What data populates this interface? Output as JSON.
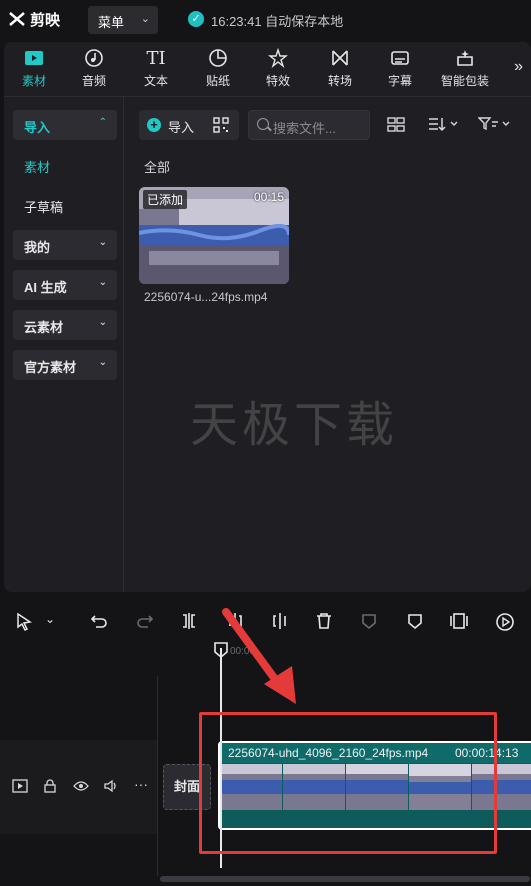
{
  "app": {
    "logo_text": "剪映",
    "menu_label": "菜单",
    "save_status": "16:23:41 自动保存本地"
  },
  "tabs": [
    {
      "label": "素材",
      "icon": "media-play-icon",
      "active": true
    },
    {
      "label": "音频",
      "icon": "audio-note-icon"
    },
    {
      "label": "文本",
      "icon": "text-ti-icon"
    },
    {
      "label": "贴纸",
      "icon": "sticker-icon"
    },
    {
      "label": "特效",
      "icon": "effects-star-icon"
    },
    {
      "label": "转场",
      "icon": "transition-bowtie-icon"
    },
    {
      "label": "字幕",
      "icon": "subtitle-icon"
    },
    {
      "label": "智能包装",
      "icon": "smart-pack-icon"
    }
  ],
  "sidebar": {
    "items": [
      {
        "label": "导入",
        "type": "pill-active",
        "expanded": true
      },
      {
        "label": "素材",
        "type": "sub-selected"
      },
      {
        "label": "子草稿",
        "type": "sub"
      },
      {
        "label": "我的",
        "type": "pill"
      },
      {
        "label": "AI 生成",
        "type": "pill"
      },
      {
        "label": "云素材",
        "type": "pill"
      },
      {
        "label": "官方素材",
        "type": "pill"
      }
    ]
  },
  "media": {
    "import_label": "导入",
    "search_placeholder": "搜索文件...",
    "section_label": "全部",
    "card": {
      "badge": "已添加",
      "duration": "00:15",
      "filename": "2256074-u...24fps.mp4"
    },
    "watermark": "天极下载"
  },
  "timeline": {
    "ruler_time": "00:00",
    "cover_label": "封面",
    "clip": {
      "name": "2256074-uhd_4096_2160_24fps.mp4",
      "duration": "00:00:14:13"
    }
  },
  "colors": {
    "accent": "#21c8c8",
    "highlight": "#e53a3a"
  }
}
